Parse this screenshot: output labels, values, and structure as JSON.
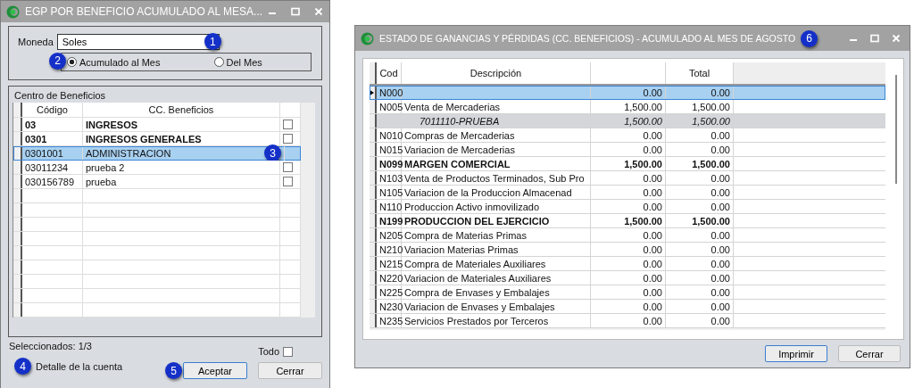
{
  "dialog": {
    "title": "EGP POR BENEFICIO ACUMULADO AL MESA...",
    "moneda": {
      "label": "Moneda",
      "value": "Soles",
      "badge": "1"
    },
    "period_options": [
      {
        "label": "Acumulado al Mes",
        "selected": true,
        "badge": "2"
      },
      {
        "label": "Del Mes",
        "selected": false
      }
    ],
    "group_title": "Centro de Beneficios",
    "columns": [
      "Código",
      "CC. Beneficios"
    ],
    "rows": [
      {
        "code": "03",
        "name": "INGRESOS",
        "bold": true,
        "selected": false,
        "checked": false
      },
      {
        "code": "0301",
        "name": "INGRESOS GENERALES",
        "bold": true,
        "selected": false,
        "checked": false
      },
      {
        "code": "0301001",
        "name": "ADMINISTRACION",
        "bold": false,
        "selected": true,
        "badge": "3"
      },
      {
        "code": "03011234",
        "name": "prueba 2",
        "bold": false,
        "selected": false,
        "checked": false
      },
      {
        "code": "030156789",
        "name": "prueba",
        "bold": false,
        "selected": false,
        "checked": false
      }
    ],
    "selected_count": "Seleccionados: 1/3",
    "todo": {
      "label": "Todo",
      "checked": false
    },
    "detalle": {
      "label": "Detalle de la cuenta",
      "badge": "4"
    },
    "buttons": [
      {
        "label": "Aceptar",
        "default": true,
        "badge": "5"
      },
      {
        "label": "Cerrar",
        "default": false
      }
    ]
  },
  "report": {
    "title": "ESTADO DE GANANCIAS Y PÉRDIDAS (CC. BENEFICIOS) - ACUMULADO AL MES DE AGOSTO",
    "badge": "6",
    "columns": [
      "Cod",
      "Descripción",
      "Total"
    ],
    "rows": [
      {
        "kind": "normal",
        "code": "N000",
        "desc": "",
        "value": "0.00",
        "total": "0.00",
        "selected": true
      },
      {
        "kind": "normal",
        "code": "N005",
        "desc": "Venta de Mercaderias",
        "value": "1,500.00",
        "total": "1,500.00",
        "selected": false
      },
      {
        "kind": "detail",
        "code": "",
        "desc": "7011110-PRUEBA",
        "value": "1,500.00",
        "total": "1,500.00",
        "selected": false
      },
      {
        "kind": "normal",
        "code": "N010",
        "desc": "Compras de Mercaderias",
        "value": "0.00",
        "total": "0.00",
        "selected": false
      },
      {
        "kind": "normal",
        "code": "N015",
        "desc": "Variacion de  Mercaderias",
        "value": "0.00",
        "total": "0.00",
        "selected": false
      },
      {
        "kind": "total",
        "code": "N099",
        "desc": "MARGEN COMERCIAL",
        "value": "1,500.00",
        "total": "1,500.00",
        "selected": false
      },
      {
        "kind": "normal",
        "code": "N103",
        "desc": "Venta de Productos Terminados, Sub Pro",
        "value": "0.00",
        "total": "0.00",
        "selected": false
      },
      {
        "kind": "normal",
        "code": "N105",
        "desc": "Variacion de la Produccion Almacenad",
        "value": "0.00",
        "total": "0.00",
        "selected": false
      },
      {
        "kind": "normal",
        "code": "N110",
        "desc": "Produccion Activo inmovilizado",
        "value": "0.00",
        "total": "0.00",
        "selected": false
      },
      {
        "kind": "total",
        "code": "N199",
        "desc": "PRODUCCION DEL EJERCICIO",
        "value": "1,500.00",
        "total": "1,500.00",
        "selected": false
      },
      {
        "kind": "normal",
        "code": "N205",
        "desc": "Compra de Materias Primas",
        "value": "0.00",
        "total": "0.00",
        "selected": false
      },
      {
        "kind": "normal",
        "code": "N210",
        "desc": "Variacion Materias Primas",
        "value": "0.00",
        "total": "0.00",
        "selected": false
      },
      {
        "kind": "normal",
        "code": "N215",
        "desc": "Compra de  Materiales  Auxiliares",
        "value": "0.00",
        "total": "0.00",
        "selected": false
      },
      {
        "kind": "normal",
        "code": "N220",
        "desc": "Variacion de Materiales Auxiliares",
        "value": "0.00",
        "total": "0.00",
        "selected": false
      },
      {
        "kind": "normal",
        "code": "N225",
        "desc": "Compra de  Envases  y  Embalajes",
        "value": "0.00",
        "total": "0.00",
        "selected": false
      },
      {
        "kind": "normal",
        "code": "N230",
        "desc": "Variacion  de  Envases y  Embalajes",
        "value": "0.00",
        "total": "0.00",
        "selected": false
      },
      {
        "kind": "normal",
        "code": "N235",
        "desc": "Servicios  Prestados por  Terceros",
        "value": "0.00",
        "total": "0.00",
        "selected": false
      }
    ],
    "buttons": [
      {
        "label": "Imprimir",
        "default": true
      },
      {
        "label": "Cerrar",
        "default": false
      }
    ]
  }
}
